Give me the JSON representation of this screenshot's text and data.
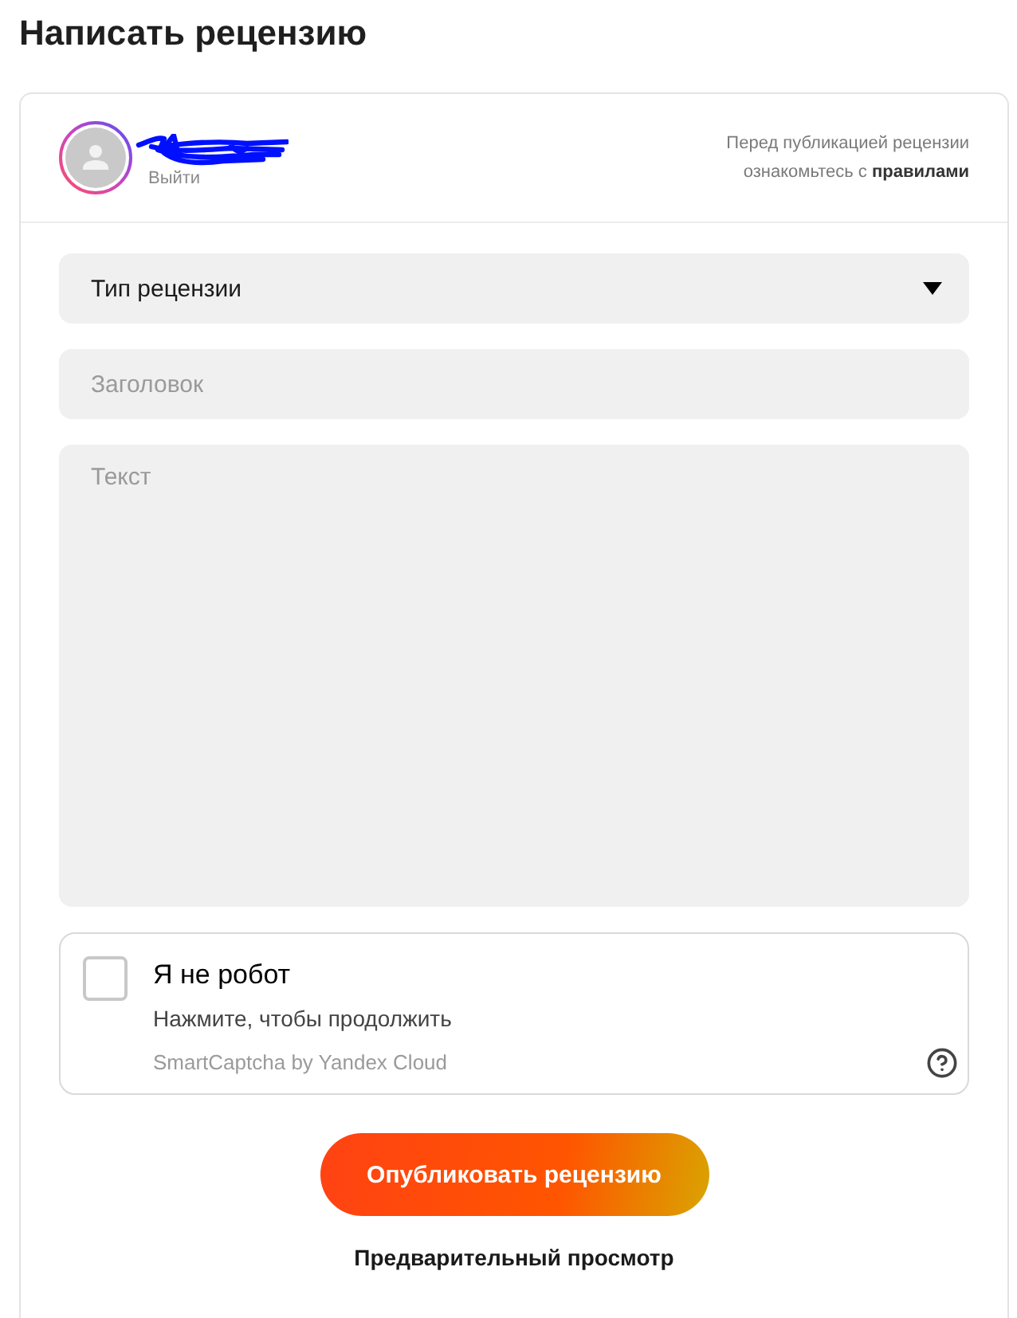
{
  "page": {
    "title": "Написать рецензию"
  },
  "user": {
    "logout": "Выйти",
    "notice": {
      "text": "Перед публикацией рецензии ознакомьтесь с",
      "link": "правилами"
    }
  },
  "form": {
    "review_type": {
      "value": "Тип рецензии"
    },
    "title_field": {
      "placeholder": "Заголовок"
    },
    "text_field": {
      "placeholder": "Текст"
    }
  },
  "captcha": {
    "checked": false,
    "label": "Я не робот",
    "hint": "Нажмите, чтобы продолжить",
    "brand": "SmartCaptcha by Yandex Cloud"
  },
  "actions": {
    "publish": "Опубликовать рецензию",
    "preview": "Предварительный просмотр"
  }
}
